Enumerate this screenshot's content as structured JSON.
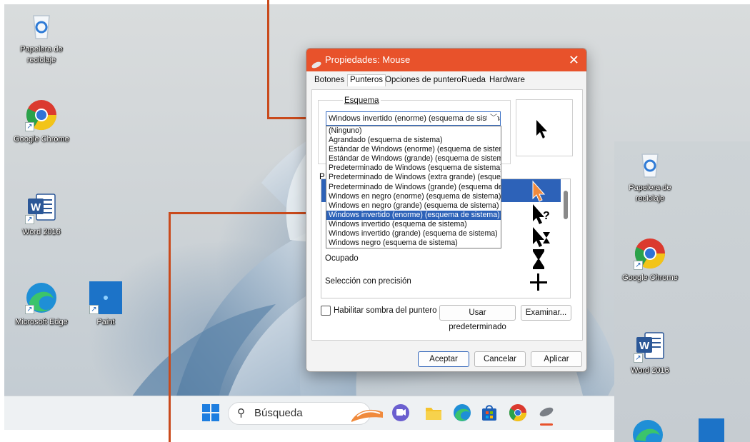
{
  "desktop_icons": [
    {
      "label_line1": "Papelera de",
      "label_line2": "reciclaje",
      "icon": "recycle-bin-icon"
    },
    {
      "label_line1": "Google Chrome",
      "label_line2": "",
      "icon": "chrome-icon"
    },
    {
      "label_line1": "Word 2016",
      "label_line2": "",
      "icon": "word-icon"
    },
    {
      "label_line1": "Microsoft Edge",
      "label_line2": "",
      "icon": "edge-icon"
    },
    {
      "label_line1": "Paint",
      "label_line2": "",
      "icon": "paint-icon"
    }
  ],
  "desktop2_icons": [
    {
      "label_line1": "Papelera de",
      "label_line2": "reciclaje"
    },
    {
      "label_line1": "Google Chrome",
      "label_line2": ""
    },
    {
      "label_line1": "Word 2016",
      "label_line2": ""
    }
  ],
  "taskbar": {
    "search_placeholder": "Búsqueda",
    "items": [
      "start-icon",
      "widgets-icon",
      "teams-icon",
      "file-explorer-icon",
      "edge-icon",
      "store-icon",
      "chrome-icon",
      "mouse-settings-icon"
    ]
  },
  "dialog": {
    "title": "Propiedades: Mouse",
    "close": "✕",
    "tabs": [
      "Botones",
      "Punteros",
      "Opciones de puntero",
      "Rueda",
      "Hardware"
    ],
    "active_tab": "Punteros",
    "scheme_label": "Esquema",
    "scheme_selected": "Windows invertido (enorme) (esquema de sistema)",
    "scheme_options": [
      "(Ninguno)",
      "Agrandado (esquema de sistema)",
      "Estándar de Windows (enorme) (esquema de sistema)",
      "Estándar de Windows (grande) (esquema de sistema)",
      "Predeterminado de Windows (esquema de sistema)",
      "Predeterminado de Windows (extra grande) (esquema de sistema)",
      "Predeterminado de Windows (grande) (esquema de sistema)",
      "Windows en negro (enorme) (esquema de sistema)",
      "Windows en negro (grande) (esquema de sistema)",
      "Windows invertido (enorme) (esquema de sistema)",
      "Windows invertido (esquema de sistema)",
      "Windows invertido (grande) (esquema de sistema)",
      "Windows negro (esquema de sistema)"
    ],
    "selected_option_index": 9,
    "customize_label_partial": "P",
    "cursor_rows": [
      "",
      "",
      "",
      "Ocupado",
      "Selección con precisión"
    ],
    "shadow_label": "Habilitar sombra del puntero",
    "use_default_button": "Usar predeterminado",
    "browse_button": "Examinar...",
    "ok_button": "Aceptar",
    "cancel_button": "Cancelar",
    "apply_button": "Aplicar"
  },
  "colors": {
    "accent_orange": "#e8522b",
    "selection_blue": "#2d62b8",
    "callout_line": "#c94a1c"
  }
}
